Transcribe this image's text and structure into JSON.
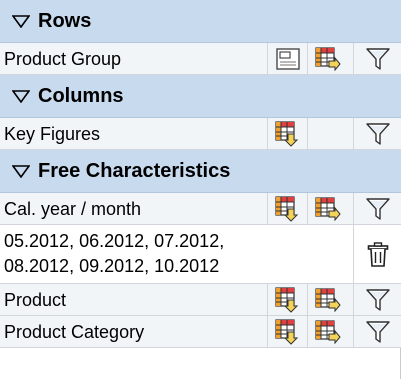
{
  "sections": {
    "rows": {
      "title": "Rows"
    },
    "columns": {
      "title": "Columns"
    },
    "free": {
      "title": "Free Characteristics"
    }
  },
  "items": {
    "product_group": "Product Group",
    "key_figures": "Key Figures",
    "cal_year_month": "Cal. year / month",
    "filter_line1": "05.2012, 06.2012, 07.2012,",
    "filter_line2": "08.2012, 09.2012, 10.2012",
    "product": "Product",
    "product_category": "Product Category"
  },
  "icons": {
    "header_toggle": "triangle-down-icon",
    "hierarchy": "hierarchy-icon",
    "swap_to_rows": "swap-to-rows-icon",
    "swap_to_columns": "swap-to-columns-icon",
    "filter": "filter-icon",
    "remove_filter": "trash-icon"
  },
  "colors": {
    "header_bg": "#c8dbee",
    "row_bg": "#f2f5f8",
    "border": "#d2d6dc",
    "icon_orange": "#f0a030",
    "icon_red": "#e04040",
    "icon_yellow": "#f4d35a"
  }
}
